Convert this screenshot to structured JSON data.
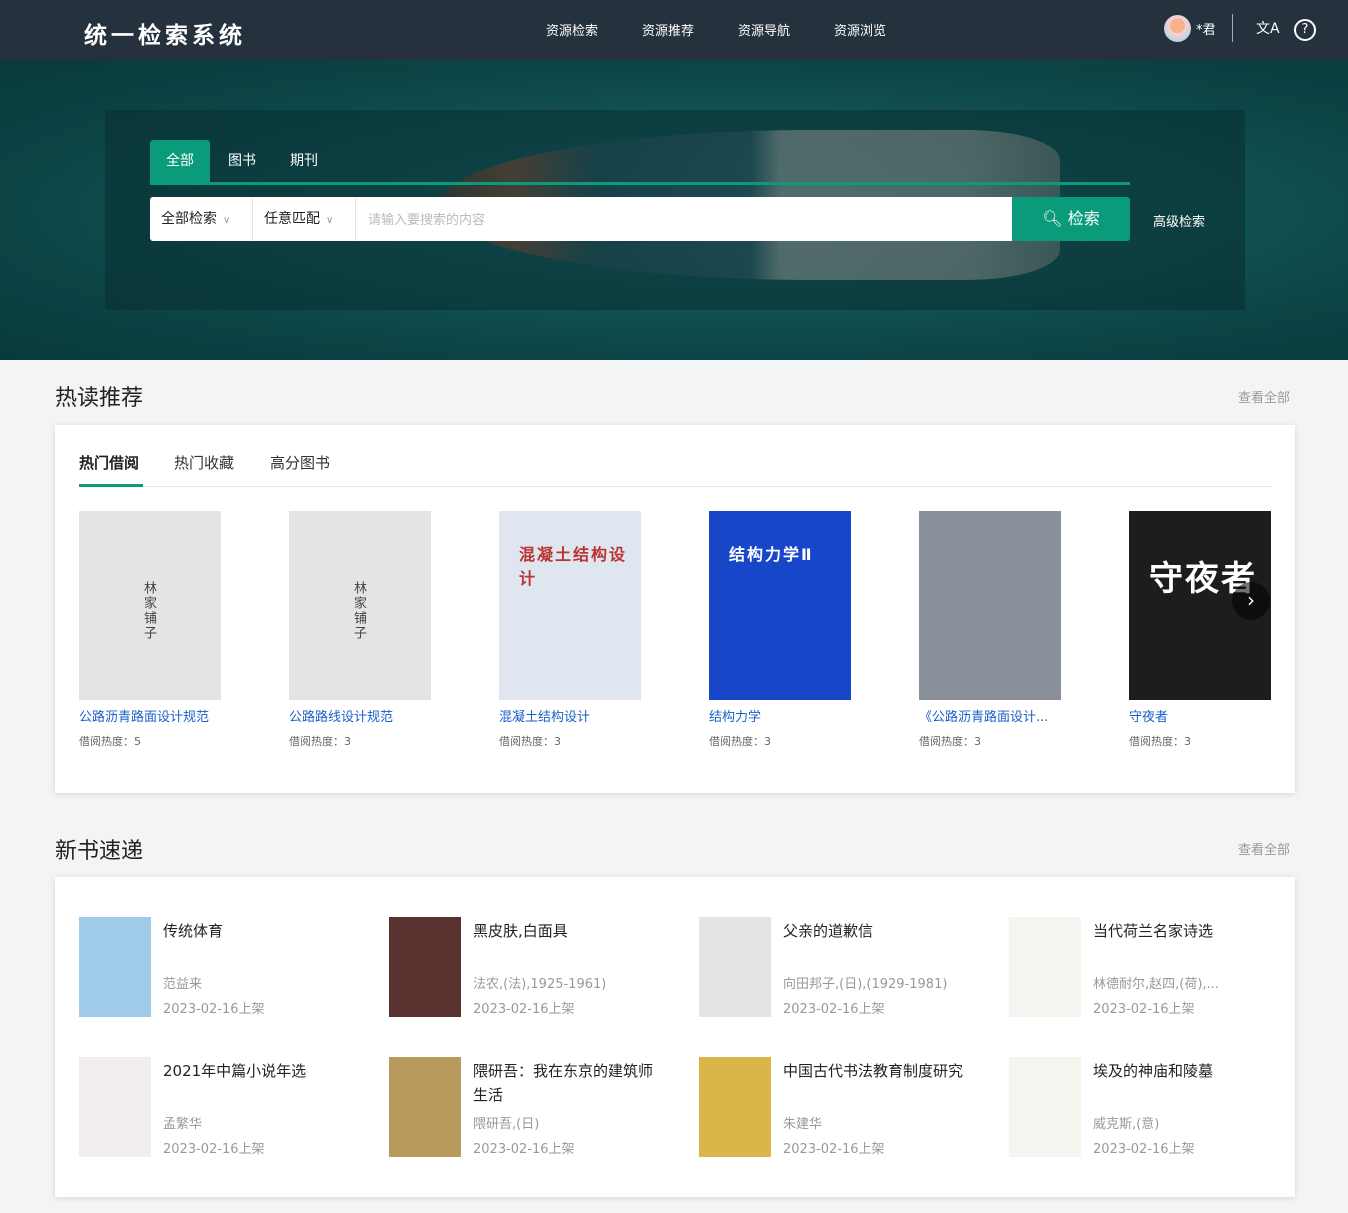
{
  "header": {
    "title": "统一检索系统",
    "nav": [
      "资源检索",
      "资源推荐",
      "资源导航",
      "资源浏览"
    ],
    "user": "*君",
    "translate_icon": "文A",
    "help_icon": "?"
  },
  "search": {
    "tabs": [
      "全部",
      "图书",
      "期刊"
    ],
    "scope": "全部检索",
    "match": "任意匹配",
    "placeholder": "请输入要搜索的内容",
    "button": "检索",
    "advanced": "高级检索"
  },
  "hot": {
    "title": "热读推荐",
    "more": "查看全部",
    "tabs": [
      "热门借阅",
      "热门收藏",
      "高分图书"
    ],
    "books": [
      {
        "title": "公路沥青路面设计规范",
        "heat": "借阅热度：5",
        "cover": "#e4e4e4",
        "cover_text": "林家铺子"
      },
      {
        "title": "公路路线设计规范",
        "heat": "借阅热度：3",
        "cover": "#e4e4e4",
        "cover_text": "林家铺子"
      },
      {
        "title": "混凝土结构设计",
        "heat": "借阅热度：3",
        "cover": "#dfe6ef",
        "cover_text": "混凝土结构设计"
      },
      {
        "title": "结构力学",
        "heat": "借阅热度：3",
        "cover": "#1747c8",
        "cover_text": "结构力学Ⅱ"
      },
      {
        "title": "《公路沥青路面设计...",
        "heat": "借阅热度：3",
        "cover": "#8a9099",
        "cover_text": ""
      },
      {
        "title": "守夜者",
        "heat": "借阅热度：3",
        "cover": "#1d1d1d",
        "cover_text": "守夜者"
      }
    ]
  },
  "newbooks": {
    "title": "新书速递",
    "more": "查看全部",
    "items": [
      {
        "title": "传统体育",
        "author": "范益来",
        "date": "2023-02-16上架",
        "cover": "#9fcbe8"
      },
      {
        "title": "黑皮肤,白面具",
        "author": "法农,(法),1925-1961)",
        "date": "2023-02-16上架",
        "cover": "#5a3330"
      },
      {
        "title": "父亲的道歉信",
        "author": "向田邦子,(日),(1929-1981)",
        "date": "2023-02-16上架",
        "cover": "#e4e4e4"
      },
      {
        "title": "当代荷兰名家诗选",
        "author": "林德耐尔,赵四,(荷),...",
        "date": "2023-02-16上架",
        "cover": "#f4f4f0"
      },
      {
        "title": "2021年中篇小说年选",
        "author": "孟繁华",
        "date": "2023-02-16上架",
        "cover": "#f2eeee"
      },
      {
        "title": "隈研吾：我在东京的建筑师生活",
        "author": "隈研吾,(日)",
        "date": "2023-02-16上架",
        "cover": "#b89a5c"
      },
      {
        "title": "中国古代书法教育制度研究",
        "author": "朱建华",
        "date": "2023-02-16上架",
        "cover": "#d9b54a"
      },
      {
        "title": "埃及的神庙和陵墓",
        "author": "威克斯,(意)",
        "date": "2023-02-16上架",
        "cover": "#f6f4ee"
      }
    ]
  }
}
